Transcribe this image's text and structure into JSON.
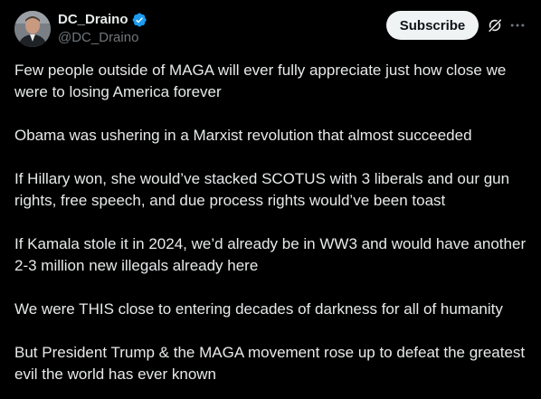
{
  "author": {
    "display_name": "DC_Draino",
    "handle": "@DC_Draino",
    "verified_icon": "verified-badge-icon",
    "accent_color": "#1d9bf0"
  },
  "actions": {
    "subscribe_label": "Subscribe",
    "grok_icon": "grok-icon",
    "more_icon": "more-options-icon"
  },
  "post": {
    "paragraphs": [
      "Few people outside of MAGA will ever fully appreciate just how close we were to losing America forever",
      "Obama was ushering in a Marxist revolution that almost succeeded",
      "If Hillary won, she would’ve stacked SCOTUS with 3 liberals and our gun rights, free speech, and due process rights would’ve been toast",
      "If Kamala stole it in 2024, we’d already be in WW3 and would have another 2-3 million new illegals already here",
      "We were THIS close to entering decades of darkness for all of humanity",
      "But President Trump & the MAGA movement rose up to defeat the greatest evil the world has ever known"
    ]
  },
  "theme": {
    "background": "#000000",
    "text": "#e7e9ea",
    "secondary_text": "#71767b",
    "button_bg": "#eff3f4"
  }
}
